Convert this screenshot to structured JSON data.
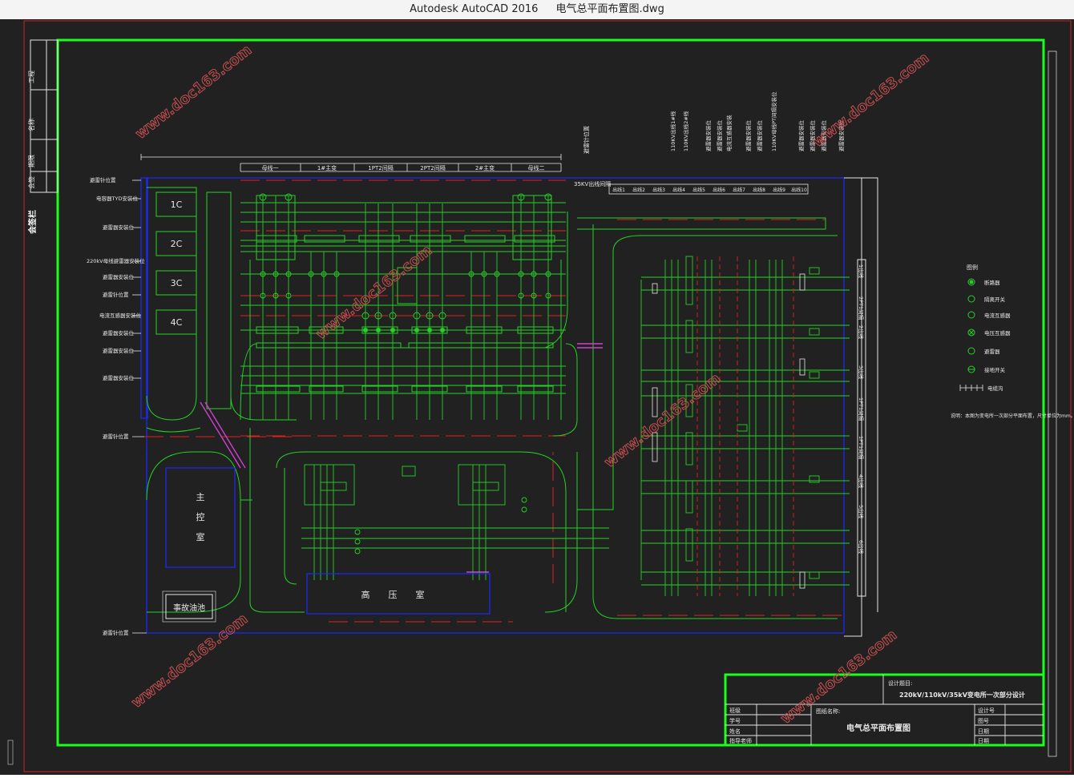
{
  "window": {
    "app_name": "Autodesk AutoCAD 2016",
    "file_name": "电气总平面布置图.dwg"
  },
  "drawing": {
    "left_strip": {
      "cells": [
        "工程",
        "名称",
        "期限",
        "会签"
      ],
      "footer": "会签栏"
    },
    "bays_top": [
      "母线一",
      "1#主变",
      "1PT2间隔",
      "2PT2间隔",
      "2#主变",
      "母线二"
    ],
    "bays_35kv_title": "35KV出线间隔",
    "bays_35kv": [
      "出线1",
      "出线2",
      "出线3",
      "出线4",
      "出线5",
      "出线6",
      "出线7",
      "出线8",
      "出线9",
      "出线10"
    ],
    "top_right_labels": [
      "110KV出线1#线",
      "110KV出线2#线",
      "避雷器安装位",
      "避雷器安装位",
      "电流互感器安装",
      "避雷器安装位",
      "避雷器安装位",
      "110KV母线PT间隔安装位",
      "避雷器安装位",
      "避雷器安装位",
      "避雷器安装位",
      "避雷器安装位"
    ],
    "top_mid_label": "避雷针位置",
    "left_labels": [
      "避雷针位置",
      "电容器TYD安装位",
      "避雷器安装位",
      "220kV母线避雷器安装位",
      "避雷器安装位",
      "避雷针位置",
      "电流互感器安装位",
      "避雷器安装位",
      "避雷器安装位",
      "避雷器安装位",
      "避雷针位置",
      "避雷针位置"
    ],
    "capacitors": [
      "1C",
      "2C",
      "3C",
      "4C"
    ],
    "main_control": [
      "主",
      "控",
      "室"
    ],
    "oil_pool": "事故油池",
    "hv_room": [
      "高",
      "压",
      "室"
    ],
    "right_labels": [
      "1出线",
      "2PT1间隔",
      "2出线",
      "3出线",
      "1PT1间隔",
      "1PT1间隔",
      "4出线",
      "5出线",
      "6出线"
    ],
    "legend": {
      "title": "图例",
      "items": [
        "断路器",
        "隔离开关",
        "电流互感器",
        "电压互感器",
        "避雷器",
        "接地开关",
        "电缆沟"
      ],
      "note": "说明：本图为变电所一次部分平面布置，尺寸单位为mm。"
    },
    "watermark": "www.doc163.com",
    "title_block": {
      "design_title_label": "设计题目:",
      "design_title": "220kV/110kV/35kV变电所一次部分设计",
      "drawing_name_label": "图纸名称:",
      "drawing_name": "电气总平面布置图",
      "left_rows": [
        "班级",
        "学号",
        "姓名",
        "指导老师"
      ],
      "right_rows": [
        "设计号",
        "图号",
        "日期",
        "日期"
      ]
    },
    "colors": {
      "bg": "#212121",
      "frame": "#1aff1a",
      "bus": "#23d323",
      "blue": "#1a2aff",
      "red": "#e02020",
      "magenta": "#d040d0",
      "white": "#e8e8e8",
      "wm": "#c85050"
    }
  }
}
